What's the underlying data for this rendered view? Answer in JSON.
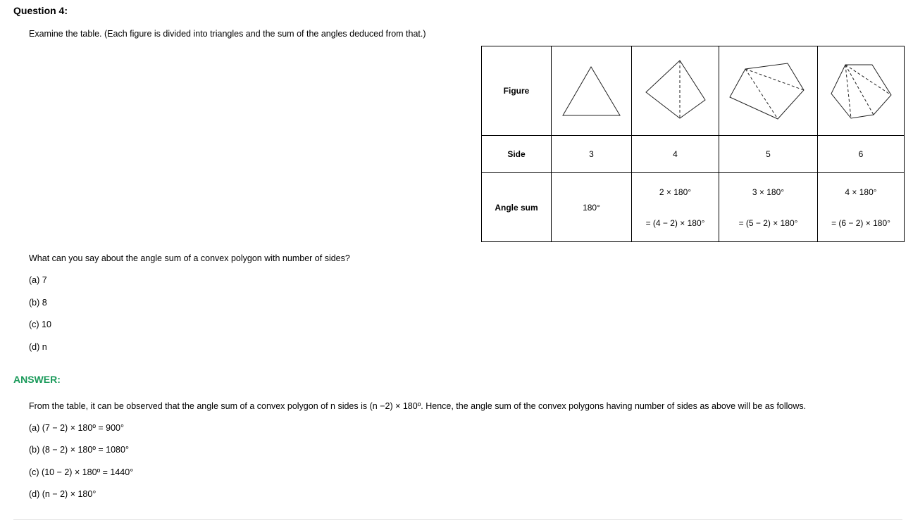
{
  "question": {
    "title": "Question 4:",
    "intro": "Examine the table. (Each figure is divided into triangles and the sum of the angles deduced from that.)",
    "prompt": "What can you say about the angle sum of a convex polygon with number of sides?",
    "options": [
      "(a) 7",
      "(b) 8",
      "(c) 10",
      "(d) n"
    ]
  },
  "table": {
    "row_labels": [
      "Figure",
      "Side",
      "Angle sum"
    ],
    "sides": [
      "3",
      "4",
      "5",
      "6"
    ],
    "angle_sum_line1": [
      "180°",
      "2 × 180°",
      "3 × 180°",
      "4 × 180°"
    ],
    "angle_sum_line2": [
      "",
      "= (4 − 2) × 180°",
      "= (5 − 2) × 180°",
      "= (6 − 2) × 180°"
    ],
    "figures": [
      "triangle",
      "quadrilateral-with-diagonal",
      "pentagon-with-diagonals",
      "hexagon-with-diagonals"
    ]
  },
  "answer": {
    "label": "ANSWER:",
    "explanation": "From the table, it can be observed that the angle sum of a convex polygon of n sides is (n −2) × 180º. Hence, the angle sum of the convex polygons having number of sides as above will be as follows.",
    "items": [
      "(a) (7 − 2) × 180º = 900°",
      "(b) (8 − 2) × 180º = 1080°",
      "(c) (10 − 2) × 180º = 1440°",
      "(d) (n − 2) × 180°"
    ]
  }
}
